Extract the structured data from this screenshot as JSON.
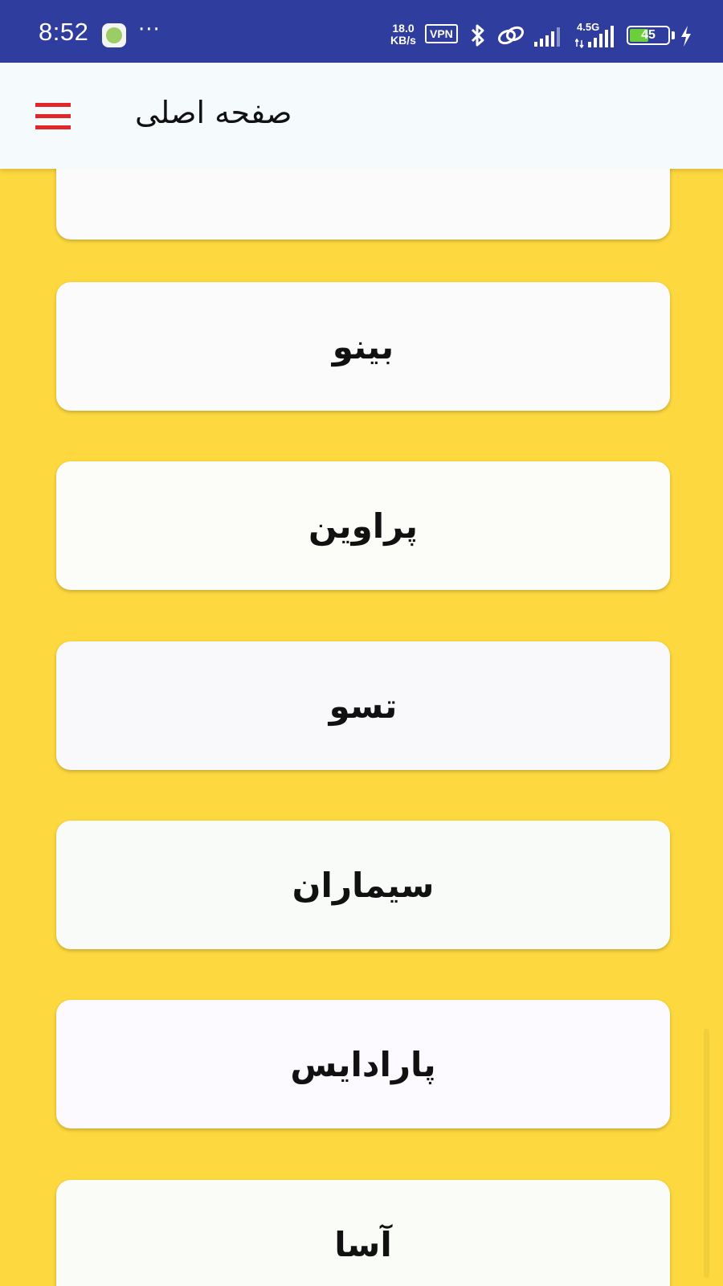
{
  "status_bar": {
    "time": "8:52",
    "more": "···",
    "net_speed_value": "18.0",
    "net_speed_unit": "KB/s",
    "vpn": "VPN",
    "network_type": "4.5G",
    "battery": "45"
  },
  "app_bar": {
    "title": "صفحه اصلی"
  },
  "list": {
    "items": [
      {
        "label": ""
      },
      {
        "label": "بینو"
      },
      {
        "label": "پراوین"
      },
      {
        "label": "تسو"
      },
      {
        "label": "سیماران"
      },
      {
        "label": "پارادایس"
      },
      {
        "label": "آسا"
      }
    ]
  },
  "colors": {
    "status_bar": "#2f3d9f",
    "background": "#fdd83f",
    "menu_icon": "#e3262a",
    "app_bar": "#f5fbfc"
  }
}
